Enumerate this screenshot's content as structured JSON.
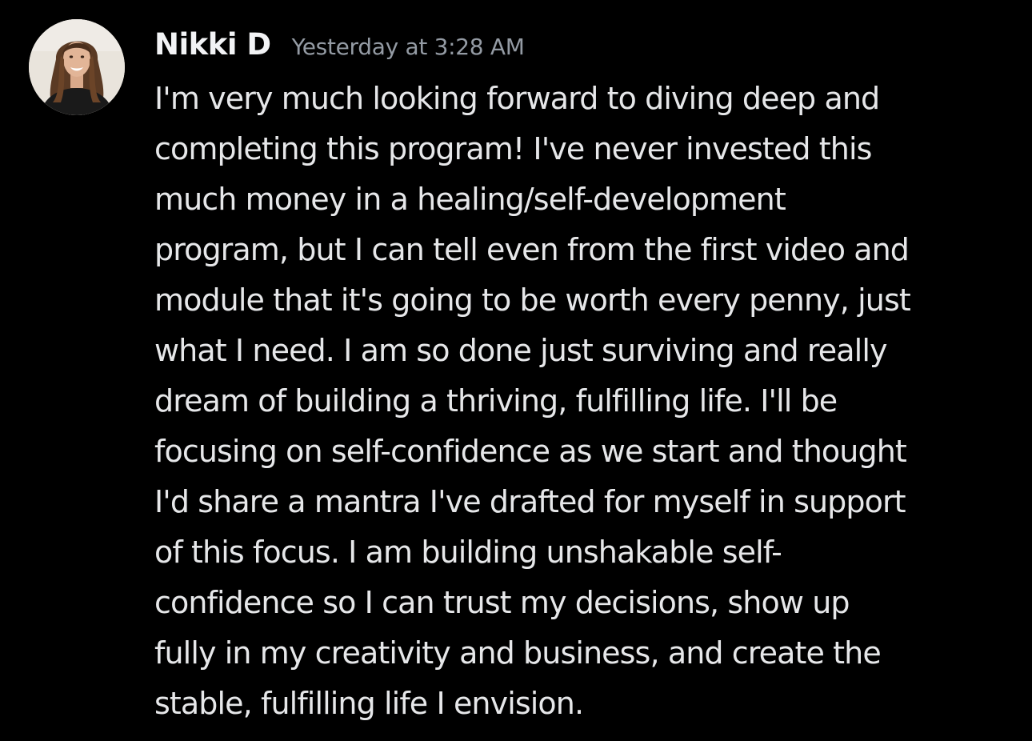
{
  "message": {
    "author": "Nikki D",
    "timestamp": "Yesterday at 3:28 AM",
    "avatar_icon": "user-avatar-photo",
    "lines": [
      "I'm very much looking forward to diving deep and",
      "completing this program! I've never invested this",
      "much money in a healing/self-development",
      "program, but I can tell even from the first video and",
      "module that it's going to be worth every penny, just",
      "what I need. I am so done just surviving and really",
      "dream of building a thriving, fulfilling life. I'll be",
      "focusing on self-confidence as we start and thought",
      "I'd share a mantra I've drafted for myself in support",
      "of this focus. I am building unshakable self-",
      "confidence so I can trust my decisions, show up",
      "fully in my creativity and business, and create the",
      "stable, fulfilling life I envision."
    ]
  },
  "colors": {
    "background": "#000000",
    "author": "#f2f3f5",
    "timestamp": "#949ba4",
    "body_text": "#e6e7e9"
  }
}
